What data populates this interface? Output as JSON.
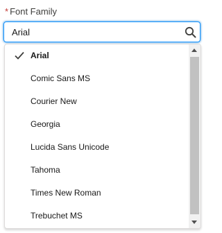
{
  "field": {
    "required_marker": "*",
    "label": "Font Family",
    "value": "Arial"
  },
  "dropdown": {
    "options": [
      {
        "label": "Arial",
        "selected": true
      },
      {
        "label": "Comic Sans MS",
        "selected": false
      },
      {
        "label": "Courier New",
        "selected": false
      },
      {
        "label": "Georgia",
        "selected": false
      },
      {
        "label": "Lucida Sans Unicode",
        "selected": false
      },
      {
        "label": "Tahoma",
        "selected": false
      },
      {
        "label": "Times New Roman",
        "selected": false
      },
      {
        "label": "Trebuchet MS",
        "selected": false
      }
    ]
  },
  "icons": {
    "search": "search-icon",
    "check": "check-icon"
  },
  "colors": {
    "focus_border": "#1b96ff",
    "required": "#c23934",
    "text": "#181818"
  }
}
